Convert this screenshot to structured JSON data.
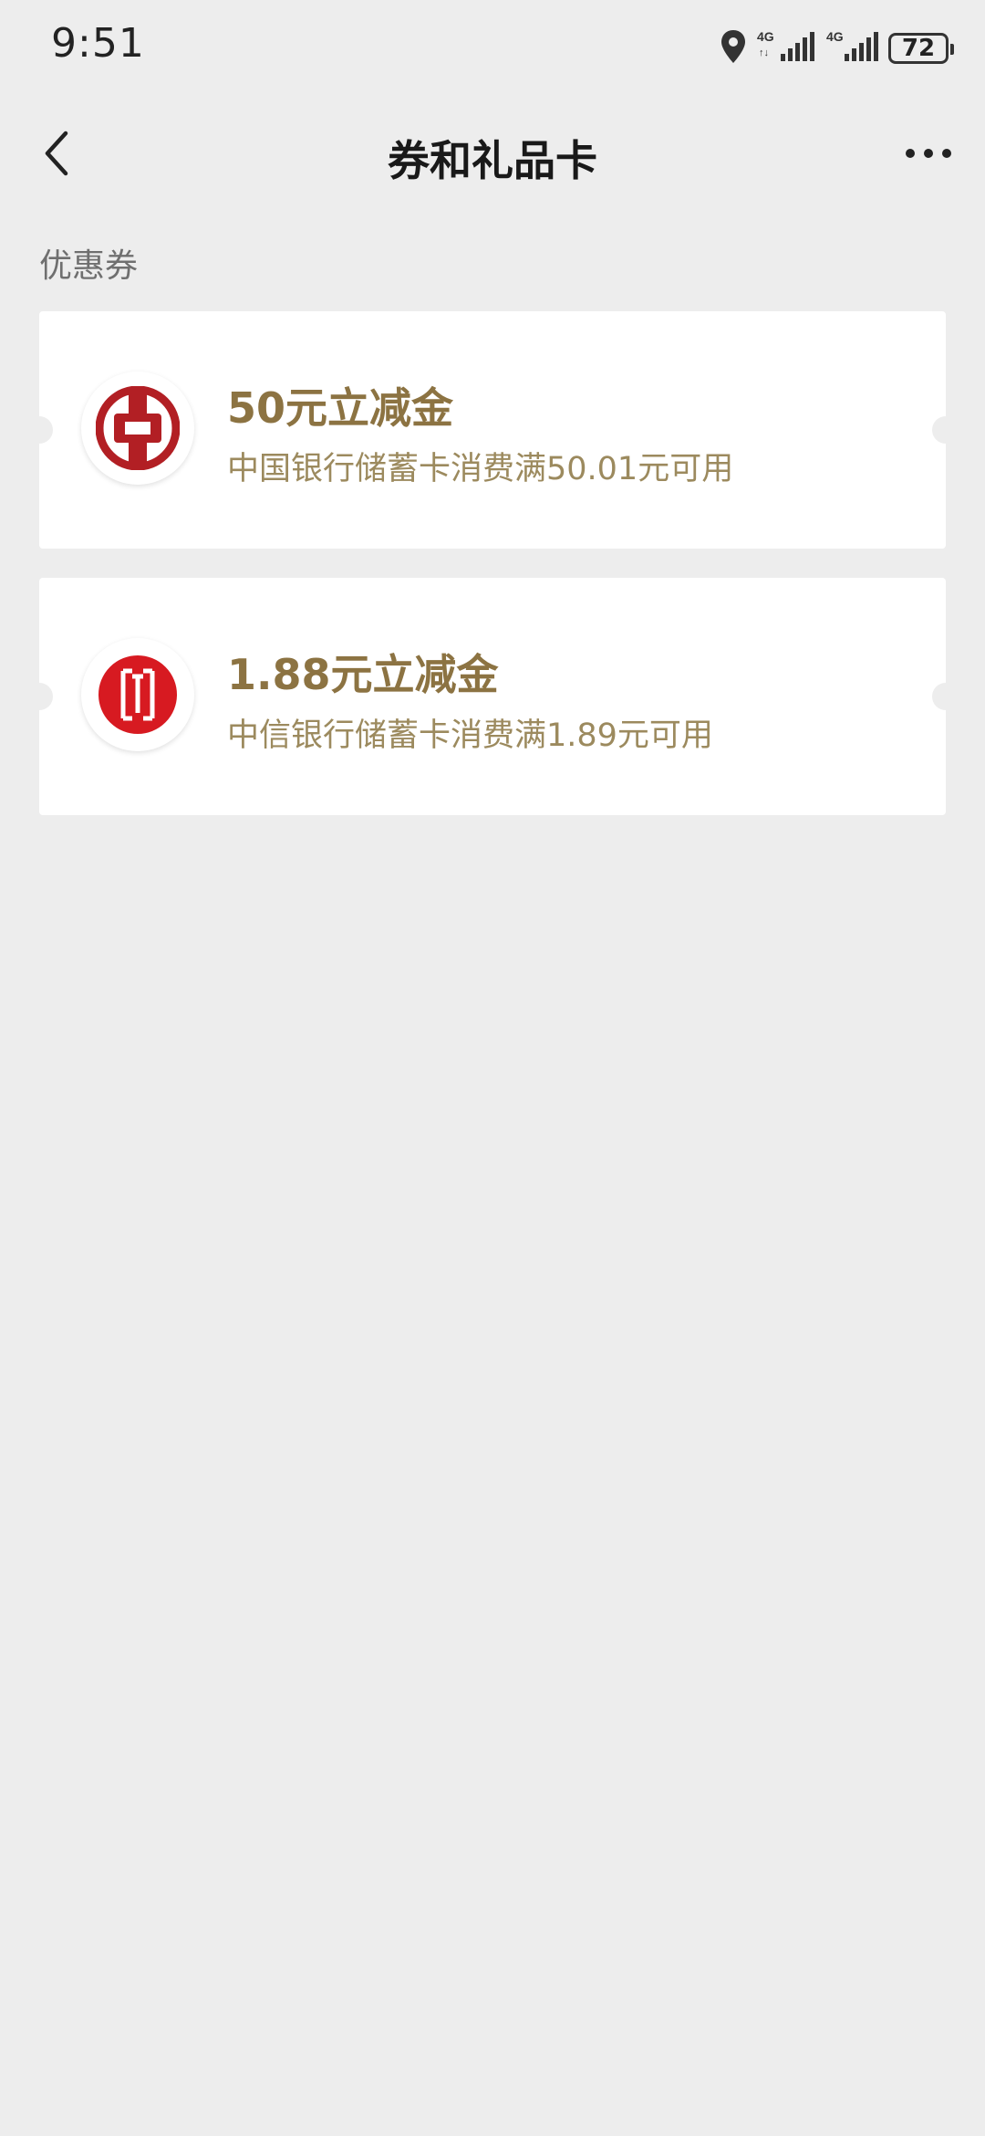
{
  "status_bar": {
    "time": "9:51",
    "battery_level": "72",
    "icons": [
      "location-icon",
      "signal-4g-icon",
      "signal-4g-icon",
      "battery-icon"
    ]
  },
  "nav": {
    "title": "券和礼品卡",
    "back_icon": "chevron-left-icon",
    "more_icon": "more-dots-icon"
  },
  "section": {
    "label": "优惠券"
  },
  "coupons": [
    {
      "title": "50元立减金",
      "description": "中国银行储蓄卡消费满50.01元可用",
      "logo_icon": "bank-of-china-logo",
      "logo_color": "#b21f24"
    },
    {
      "title": "1.88元立减金",
      "description": "中信银行储蓄卡消费满1.89元可用",
      "logo_icon": "citic-bank-logo",
      "logo_color": "#d71a21"
    }
  ],
  "colors": {
    "background": "#ededed",
    "card": "#ffffff",
    "coupon_title": "#8c7342",
    "coupon_desc": "#9c8a5e"
  }
}
